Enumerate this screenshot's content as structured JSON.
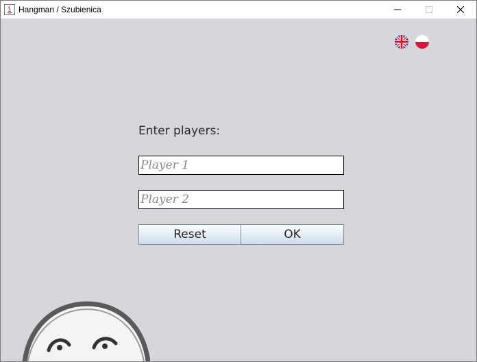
{
  "window": {
    "title": "Hangman / Szubienica"
  },
  "language_flags": [
    {
      "name": "english-flag-icon"
    },
    {
      "name": "polish-flag-icon"
    }
  ],
  "form": {
    "prompt": "Enter players:",
    "player1_placeholder": "Player 1",
    "player2_placeholder": "Player 2",
    "player1_value": "",
    "player2_value": "",
    "reset_label": "Reset",
    "ok_label": "OK"
  },
  "colors": {
    "background": "#d6d7da",
    "button_gradient_top": "#fbfdff",
    "button_gradient_bottom": "#cfdcea"
  }
}
